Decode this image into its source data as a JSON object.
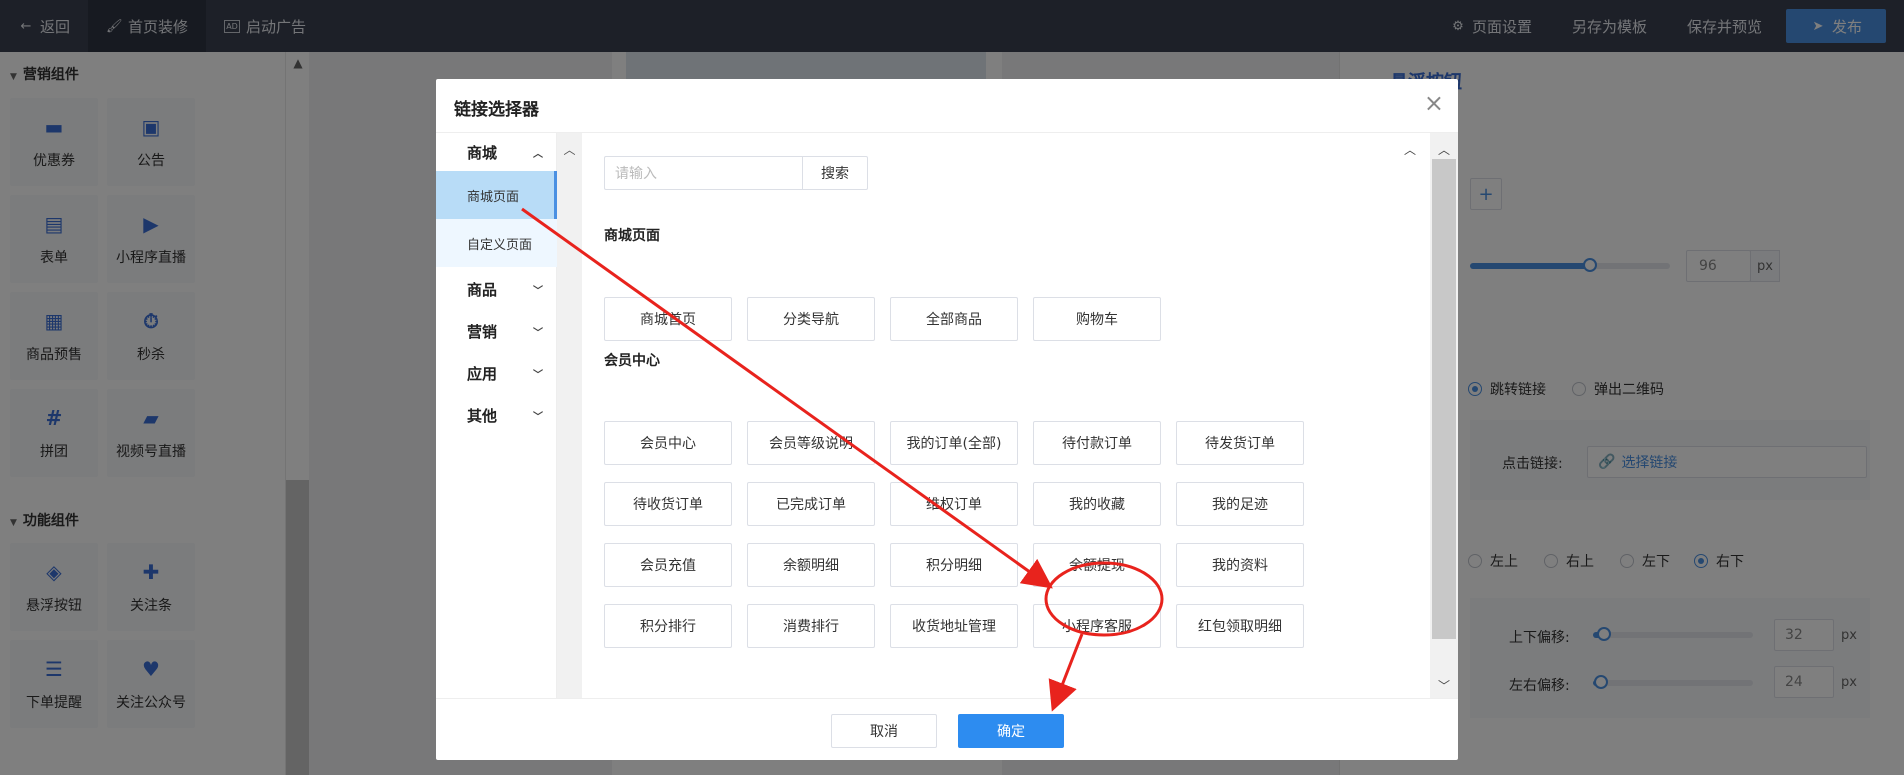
{
  "topbar": {
    "back": "返回",
    "tab_home_decor": "首页装修",
    "tab_launch_ad": "启动广告",
    "page_settings": "页面设置",
    "save_as_template": "另存为模板",
    "save_and_preview": "保存并预览",
    "publish": "发布"
  },
  "left_panel": {
    "marketing_title": "营销组件",
    "function_title": "功能组件",
    "marketing_items": [
      {
        "label": "优惠券",
        "icon": "coupon-icon"
      },
      {
        "label": "公告",
        "icon": "announcement-icon"
      },
      {
        "label": "表单",
        "icon": "form-icon"
      },
      {
        "label": "小程序直播",
        "icon": "live-icon"
      },
      {
        "label": "商品预售",
        "icon": "presale-icon"
      },
      {
        "label": "秒杀",
        "icon": "flash-sale-icon"
      },
      {
        "label": "拼团",
        "icon": "group-buy-icon"
      },
      {
        "label": "视频号直播",
        "icon": "video-icon"
      }
    ],
    "function_items": [
      {
        "label": "悬浮按钮",
        "icon": "layers-icon"
      },
      {
        "label": "关注条",
        "icon": "add-user-icon"
      },
      {
        "label": "下单提醒",
        "icon": "order-reminder-icon"
      },
      {
        "label": "关注公众号",
        "icon": "heart-icon"
      }
    ]
  },
  "right_panel": {
    "title": "悬浮按钮",
    "size_value": "96",
    "unit_px": "px",
    "radio_jump": "跳转链接",
    "radio_qrcode": "弹出二维码",
    "click_link_label": "点击链接:",
    "choose_link": "选择链接",
    "pos_top_left": "左上",
    "pos_top_right": "右上",
    "pos_bottom_left": "左下",
    "pos_bottom_right": "右下",
    "v_offset_label": "上下偏移:",
    "v_offset_value": "32",
    "h_offset_label": "左右偏移:",
    "h_offset_value": "24",
    "size_slider_fraction": 0.6,
    "v_offset_fraction": 0.07,
    "h_offset_fraction": 0.05
  },
  "modal": {
    "title": "链接选择器",
    "nav": {
      "mall": "商城",
      "mall_page": "商城页面",
      "custom_page": "自定义页面",
      "goods": "商品",
      "marketing": "营销",
      "apps": "应用",
      "other": "其他"
    },
    "search_placeholder": "请输入",
    "search_button": "搜索",
    "group_mall_title": "商城页面",
    "group_member_title": "会员中心",
    "mall_links": [
      "商城首页",
      "分类导航",
      "全部商品",
      "购物车"
    ],
    "member_links": [
      [
        "会员中心",
        "会员等级说明",
        "我的订单(全部)",
        "待付款订单",
        "待发货订单"
      ],
      [
        "待收货订单",
        "已完成订单",
        "维权订单",
        "我的收藏",
        "我的足迹"
      ],
      [
        "会员充值",
        "余额明细",
        "积分明细",
        "余额提现",
        "我的资料"
      ],
      [
        "积分排行",
        "消费排行",
        "收货地址管理",
        "小程序客服",
        "红包领取明细"
      ]
    ],
    "cancel": "取消",
    "confirm": "确定"
  },
  "annotation_color": "#e8231d",
  "accent_color": "#2d8cf0"
}
